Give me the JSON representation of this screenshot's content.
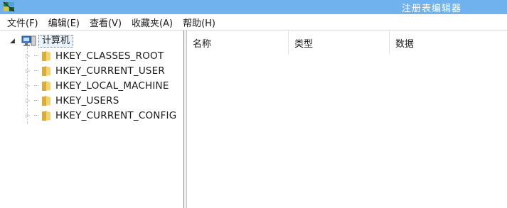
{
  "window": {
    "title": "注册表编辑器",
    "icon": "regedit-icon"
  },
  "menu": {
    "items": [
      {
        "label": "文件(F)"
      },
      {
        "label": "编辑(E)"
      },
      {
        "label": "查看(V)"
      },
      {
        "label": "收藏夹(A)"
      },
      {
        "label": "帮助(H)"
      }
    ]
  },
  "tree": {
    "root": {
      "label": "计算机",
      "icon": "computer-icon",
      "expanded": true
    },
    "items": [
      {
        "label": "HKEY_CLASSES_ROOT",
        "icon": "folder-icon"
      },
      {
        "label": "HKEY_CURRENT_USER",
        "icon": "folder-icon"
      },
      {
        "label": "HKEY_LOCAL_MACHINE",
        "icon": "folder-icon"
      },
      {
        "label": "HKEY_USERS",
        "icon": "folder-icon"
      },
      {
        "label": "HKEY_CURRENT_CONFIG",
        "icon": "folder-icon"
      }
    ]
  },
  "list": {
    "columns": [
      {
        "label": "名称"
      },
      {
        "label": "类型"
      },
      {
        "label": "数据"
      }
    ]
  },
  "colors": {
    "titlebar": "#6fb2ed",
    "folder": "#e8c45a",
    "selection": "#e9f3fd"
  }
}
